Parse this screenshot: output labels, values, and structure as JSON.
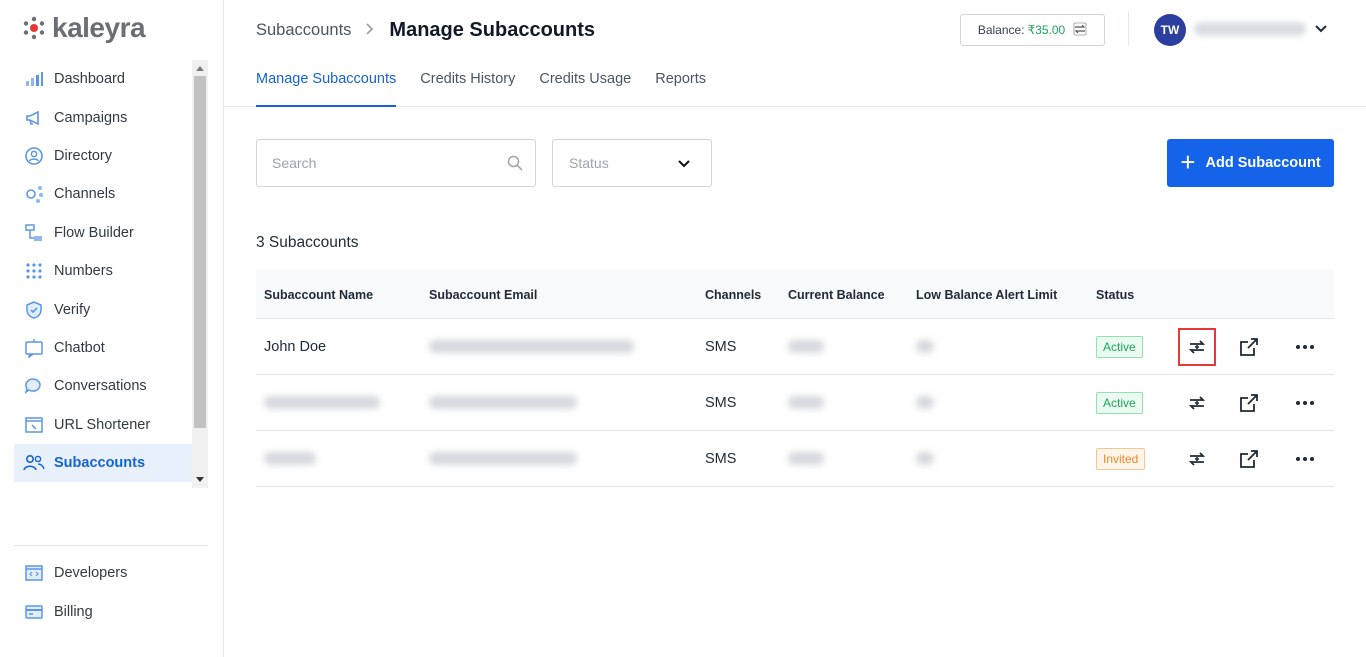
{
  "brand": {
    "name": "kaleyra",
    "accent": "#1463d8"
  },
  "sidebar": {
    "items": [
      {
        "label": "Dashboard",
        "icon": "bar-chart-icon"
      },
      {
        "label": "Campaigns",
        "icon": "megaphone-icon"
      },
      {
        "label": "Directory",
        "icon": "contact-icon"
      },
      {
        "label": "Channels",
        "icon": "channels-icon"
      },
      {
        "label": "Flow Builder",
        "icon": "flow-icon"
      },
      {
        "label": "Numbers",
        "icon": "dialpad-icon"
      },
      {
        "label": "Verify",
        "icon": "shield-icon"
      },
      {
        "label": "Chatbot",
        "icon": "chatbot-icon"
      },
      {
        "label": "Conversations",
        "icon": "chat-bubbles-icon"
      },
      {
        "label": "URL Shortener",
        "icon": "link-icon"
      },
      {
        "label": "Subaccounts",
        "icon": "users-icon",
        "active": true
      }
    ],
    "bottom_items": [
      {
        "label": "Developers",
        "icon": "code-icon"
      },
      {
        "label": "Billing",
        "icon": "card-icon"
      }
    ]
  },
  "header": {
    "breadcrumb_parent": "Subaccounts",
    "breadcrumb_separator": ">",
    "title": "Manage Subaccounts",
    "balance_label": "Balance:",
    "balance_amount": "₹35.00",
    "avatar_initials": "TW",
    "tabs": [
      {
        "label": "Manage Subaccounts",
        "active": true
      },
      {
        "label": "Credits History"
      },
      {
        "label": "Credits Usage"
      },
      {
        "label": "Reports"
      }
    ]
  },
  "filters": {
    "search_placeholder": "Search",
    "status_placeholder": "Status",
    "add_button": "Add Subaccount"
  },
  "table": {
    "count_label": "3 Subaccounts",
    "columns": [
      "Subaccount Name",
      "Subaccount Email",
      "Channels",
      "Current Balance",
      "Low Balance Alert Limit",
      "Status"
    ],
    "rows": [
      {
        "name": "John Doe",
        "channels": "SMS",
        "status": "Active"
      },
      {
        "channels": "SMS",
        "status": "Active"
      },
      {
        "channels": "SMS",
        "status": "Invited"
      }
    ]
  },
  "colors": {
    "active": "#1aa45b",
    "invited": "#e88a2a",
    "primary_button": "#1463e8",
    "highlight": "#e53935"
  }
}
